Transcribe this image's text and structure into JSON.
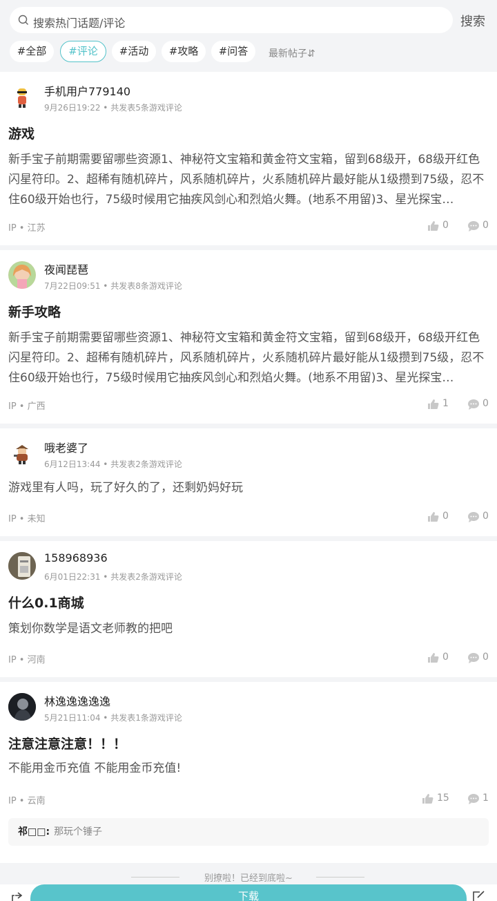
{
  "search": {
    "placeholder": "搜索热门话题/评论",
    "button": "搜索"
  },
  "tabs": [
    "#全部",
    "#评论",
    "#活动",
    "#攻略",
    "#问答"
  ],
  "sort_label": "最新帖子⇵",
  "posts": [
    {
      "user": "手机用户779140",
      "meta": "9月26日19:22 • 共发表5条游戏评论",
      "title": "游戏",
      "body": "新手宝子前期需要留哪些资源1、神秘符文宝箱和黄金符文宝箱，留到68级开，68级开红色闪星符印。2、超稀有随机碎片，风系随机碎片，火系随机碎片最好能从1级攒到75级，忍不住60级开始也行，75级时候用它抽疾风剑心和烈焰火舞。(地系不用留)3、星光探宝…",
      "ip": "IP • 江苏",
      "likes": "0",
      "comments": "0"
    },
    {
      "user": "夜闻琵琶",
      "meta": "7月22日09:51 • 共发表8条游戏评论",
      "title": "新手攻略",
      "body": "新手宝子前期需要留哪些资源1、神秘符文宝箱和黄金符文宝箱，留到68级开，68级开红色闪星符印。2、超稀有随机碎片，风系随机碎片，火系随机碎片最好能从1级攒到75级，忍不住60级开始也行，75级时候用它抽疾风剑心和烈焰火舞。(地系不用留)3、星光探宝…",
      "ip": "IP • 广西",
      "likes": "1",
      "comments": "0"
    },
    {
      "user": "哦老婆了",
      "meta": "6月12日13:44 • 共发表2条游戏评论",
      "title": "",
      "body": "游戏里有人吗，玩了好久的了，还剩奶妈好玩",
      "ip": "IP • 未知",
      "likes": "0",
      "comments": "0"
    },
    {
      "user": "158968936",
      "meta": "6月01日22:31 • 共发表2条游戏评论",
      "title": "什么0.1商城",
      "body": "策划你数学是语文老师教的把吧",
      "ip": "IP • 河南",
      "likes": "0",
      "comments": "0"
    },
    {
      "user": "林逸逸逸逸逸",
      "meta": "5月21日11:04 • 共发表1条游戏评论",
      "title": "注意注意注意！！！",
      "body": "不能用金币充值 不能用金币充值!",
      "ip": "IP • 云南",
      "likes": "15",
      "comments": "1",
      "reply_user": "祁□□:",
      "reply_text": "那玩个锤子"
    }
  ],
  "end_text": "别撩啦！已经到底啦~",
  "download_label": "下载"
}
